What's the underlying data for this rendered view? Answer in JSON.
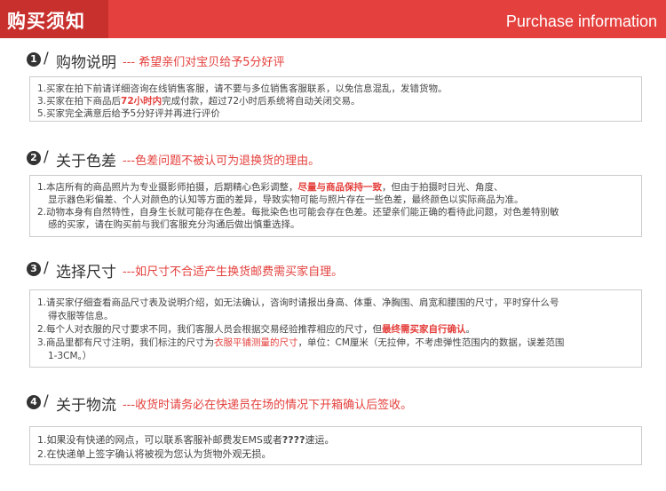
{
  "header": {
    "title": "购买须知",
    "english": "Purchase information"
  },
  "sections": [
    {
      "num": "1",
      "title": "购物说明",
      "subtitle": "--- 希望亲们对宝贝给予5分好评",
      "lines": [
        [
          "1.买家在拍下前请详细咨询在线销售客服，请不要与多位销售客服联系，以免信息混乱，发错货物。"
        ],
        [
          "3.买家在拍下商品后",
          "72小时内",
          "完成付款，超过72小时后系统将自动关闭交易。"
        ],
        [
          "5.买家完全满意后给予5分好评并再进行评价"
        ]
      ]
    },
    {
      "num": "2",
      "title": "关于色差",
      "subtitle": "---色差问题不被认可为退换货的理由。",
      "lines": [
        [
          "1.本店所有的商品照片为专业摄影师拍摄，后期精心色彩调整，",
          "尽量与商品保持一致",
          "，但由于拍摄时日光、角度、"
        ],
        [
          "显示器色彩偏差、个人对颜色的认知等方面的差异，导致实物可能与照片存在一些色差，最终颜色以实际商品为准。"
        ],
        [
          "2.动物本身有自然特性，自身生长就可能存在色差。每批染色也可能会存在色差。还望亲们能正确的看待此问题，对色差特别敏"
        ],
        [
          "感的买家，请在购买前与我们客服充分沟通后做出慎重选择。"
        ]
      ]
    },
    {
      "num": "3",
      "title": "选择尺寸",
      "subtitle": "---如尺寸不合适产生换货邮费需买家自理。",
      "lines": [
        [
          "1.请买家仔细查看商品尺寸表及说明介绍，如无法确认，咨询时请报出身高、体重、净胸围、肩宽和腰围的尺寸，平时穿什么号"
        ],
        [
          "得衣服等信息。"
        ],
        [
          "2.每个人对衣服的尺寸要求不同，我们客服人员会根据交易经验推荐相应的尺寸，但",
          "最终需买家自行确认",
          "。"
        ],
        [
          "3.商品里都有尺寸注明，我们标注的尺寸为",
          "衣服平铺测量的尺寸",
          "，单位：CM厘米（无拉伸，不考虑弹性范围内的数据，误差范围"
        ],
        [
          "1-3CM。）"
        ]
      ]
    },
    {
      "num": "4",
      "title": "关于物流",
      "subtitle": "---收货时请务必在快递员在场的情况下开箱确认后签收。",
      "lines": [
        [
          "1.如果没有快递的网点，可以联系客服补邮费发EMS或者",
          "????",
          "速运。"
        ],
        [
          "2.在快递单上签字确认将被视为您认为货物外观无损。"
        ]
      ]
    }
  ]
}
